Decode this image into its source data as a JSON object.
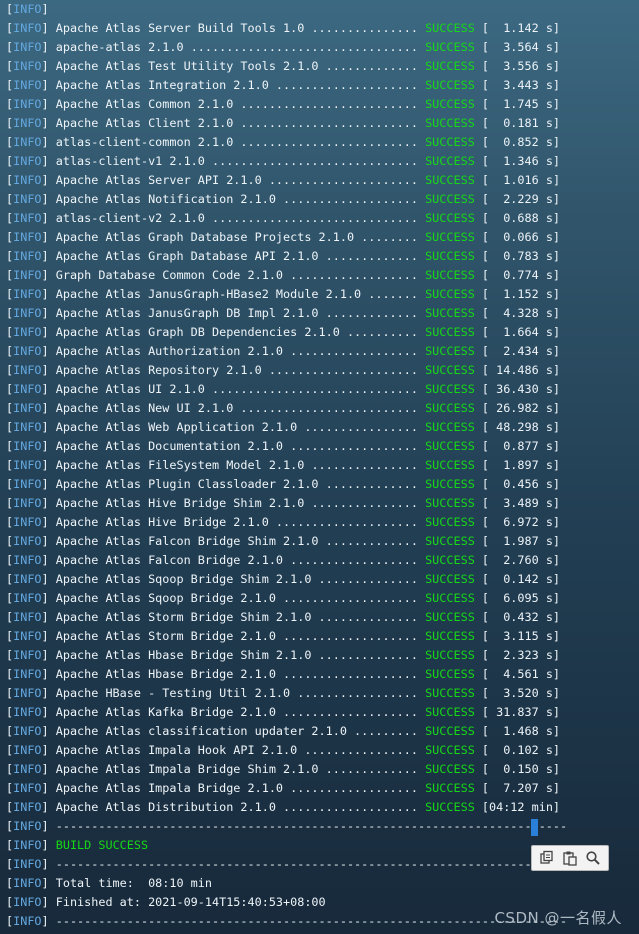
{
  "terminal": {
    "level_tag": "INFO",
    "status_label": "SUCCESS",
    "dots_width": 50,
    "top_line": "[INFO]",
    "reactor": [
      {
        "name": "Apache Atlas Server Build Tools 1.0",
        "time": "  1.142 s"
      },
      {
        "name": "apache-atlas 2.1.0",
        "time": "  3.564 s"
      },
      {
        "name": "Apache Atlas Test Utility Tools 2.1.0",
        "time": "  3.556 s"
      },
      {
        "name": "Apache Atlas Integration 2.1.0",
        "time": "  3.443 s"
      },
      {
        "name": "Apache Atlas Common 2.1.0",
        "time": "  1.745 s"
      },
      {
        "name": "Apache Atlas Client 2.1.0",
        "time": "  0.181 s"
      },
      {
        "name": "atlas-client-common 2.1.0",
        "time": "  0.852 s"
      },
      {
        "name": "atlas-client-v1 2.1.0",
        "time": "  1.346 s"
      },
      {
        "name": "Apache Atlas Server API 2.1.0",
        "time": "  1.016 s"
      },
      {
        "name": "Apache Atlas Notification 2.1.0",
        "time": "  2.229 s"
      },
      {
        "name": "atlas-client-v2 2.1.0",
        "time": "  0.688 s"
      },
      {
        "name": "Apache Atlas Graph Database Projects 2.1.0",
        "time": "  0.066 s"
      },
      {
        "name": "Apache Atlas Graph Database API 2.1.0",
        "time": "  0.783 s"
      },
      {
        "name": "Graph Database Common Code 2.1.0",
        "time": "  0.774 s"
      },
      {
        "name": "Apache Atlas JanusGraph-HBase2 Module 2.1.0",
        "time": "  1.152 s"
      },
      {
        "name": "Apache Atlas JanusGraph DB Impl 2.1.0",
        "time": "  4.328 s"
      },
      {
        "name": "Apache Atlas Graph DB Dependencies 2.1.0",
        "time": "  1.664 s"
      },
      {
        "name": "Apache Atlas Authorization 2.1.0",
        "time": "  2.434 s"
      },
      {
        "name": "Apache Atlas Repository 2.1.0",
        "time": " 14.486 s"
      },
      {
        "name": "Apache Atlas UI 2.1.0",
        "time": " 36.430 s"
      },
      {
        "name": "Apache Atlas New UI 2.1.0",
        "time": " 26.982 s"
      },
      {
        "name": "Apache Atlas Web Application 2.1.0",
        "time": " 48.298 s"
      },
      {
        "name": "Apache Atlas Documentation 2.1.0",
        "time": "  0.877 s"
      },
      {
        "name": "Apache Atlas FileSystem Model 2.1.0",
        "time": "  1.897 s"
      },
      {
        "name": "Apache Atlas Plugin Classloader 2.1.0",
        "time": "  0.456 s"
      },
      {
        "name": "Apache Atlas Hive Bridge Shim 2.1.0",
        "time": "  3.489 s"
      },
      {
        "name": "Apache Atlas Hive Bridge 2.1.0",
        "time": "  6.972 s"
      },
      {
        "name": "Apache Atlas Falcon Bridge Shim 2.1.0",
        "time": "  1.987 s"
      },
      {
        "name": "Apache Atlas Falcon Bridge 2.1.0",
        "time": "  2.760 s"
      },
      {
        "name": "Apache Atlas Sqoop Bridge Shim 2.1.0",
        "time": "  0.142 s"
      },
      {
        "name": "Apache Atlas Sqoop Bridge 2.1.0",
        "time": "  6.095 s"
      },
      {
        "name": "Apache Atlas Storm Bridge Shim 2.1.0",
        "time": "  0.432 s"
      },
      {
        "name": "Apache Atlas Storm Bridge 2.1.0",
        "time": "  3.115 s"
      },
      {
        "name": "Apache Atlas Hbase Bridge Shim 2.1.0",
        "time": "  2.323 s"
      },
      {
        "name": "Apache Atlas Hbase Bridge 2.1.0",
        "time": "  4.561 s"
      },
      {
        "name": "Apache HBase - Testing Util 2.1.0",
        "time": "  3.520 s"
      },
      {
        "name": "Apache Atlas Kafka Bridge 2.1.0",
        "time": " 31.837 s"
      },
      {
        "name": "Apache Atlas classification updater 2.1.0",
        "time": "  1.468 s"
      },
      {
        "name": "Apache Atlas Impala Hook API 2.1.0",
        "time": "  0.102 s"
      },
      {
        "name": "Apache Atlas Impala Bridge Shim 2.1.0",
        "time": "  0.150 s"
      },
      {
        "name": "Apache Atlas Impala Bridge 2.1.0",
        "time": "  7.207 s"
      },
      {
        "name": "Apache Atlas Distribution 2.1.0",
        "time": "04:12 min"
      }
    ],
    "separator": " ------------------------------------------------------------------------",
    "build_result": "BUILD SUCCESS",
    "total_time": " Total time:  08:10 min",
    "finished_at": " Finished at: 2021-09-14T15:40:53+08:00"
  },
  "toolbar": {
    "icons": [
      "copy-icon",
      "paste-icon",
      "search-icon"
    ]
  },
  "watermark": "CSDN @一名假人",
  "colors": {
    "info_tag": "#64a8e0",
    "success": "#16d916",
    "text": "#eef4f8"
  }
}
